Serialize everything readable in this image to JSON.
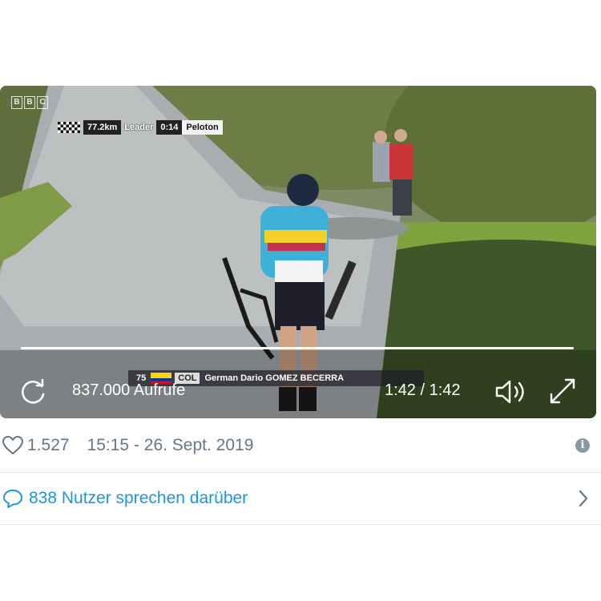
{
  "video": {
    "broadcaster_logo": "BBC",
    "race_info": {
      "distance": "77.2km",
      "leader_label": "Leader",
      "gap": "0:14",
      "peloton_label": "Peloton"
    },
    "rider": {
      "number": "75",
      "nation": "COL",
      "name": "German Dario GOMEZ BECERRA"
    },
    "views": "837.000 Aufrufe",
    "time": "1:42 / 1:42",
    "progress": 1.0
  },
  "tweet": {
    "likes": "1.527",
    "datetime": "15:15 - 26. Sept. 2019",
    "conversation": "838 Nutzer sprechen darüber"
  },
  "colors": {
    "meta_text": "#657786",
    "link": "#1b95e0",
    "divider": "#e1e8ed"
  },
  "icons": [
    "replay-icon",
    "volume-icon",
    "fullscreen-icon",
    "heart-icon",
    "info-icon",
    "speech-bubble-icon",
    "chevron-right-icon"
  ]
}
